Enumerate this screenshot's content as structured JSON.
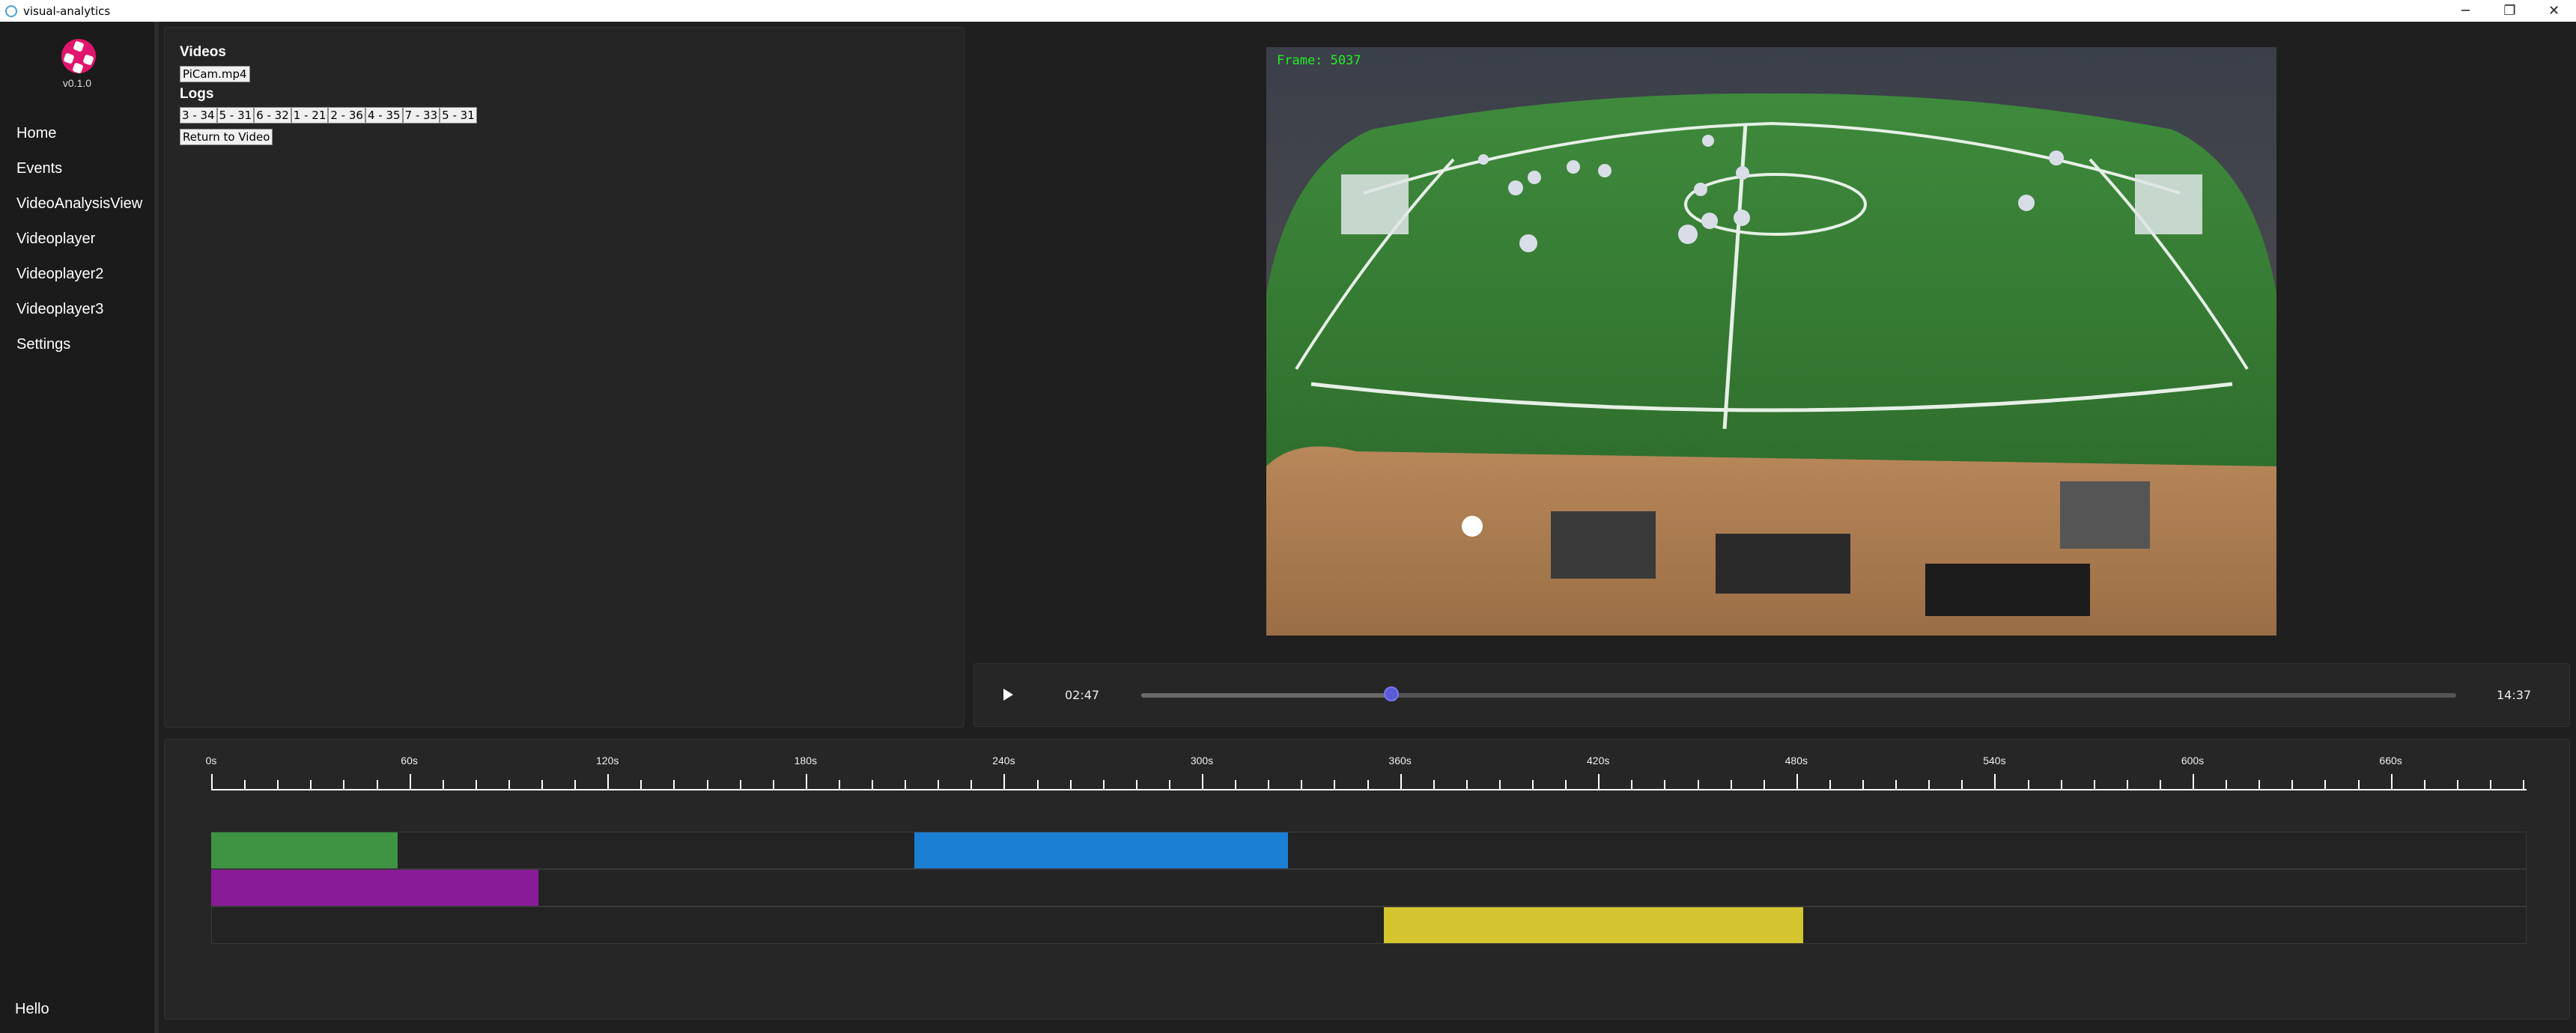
{
  "window": {
    "title": "visual-analytics",
    "controls": [
      "─",
      "❐",
      "✕"
    ]
  },
  "sidebar": {
    "version": "v0.1.0",
    "items": [
      {
        "label": "Home"
      },
      {
        "label": "Events"
      },
      {
        "label": "VideoAnalysisView"
      },
      {
        "label": "Videoplayer"
      },
      {
        "label": "Videoplayer2"
      },
      {
        "label": "Videoplayer3"
      },
      {
        "label": "Settings"
      }
    ],
    "footer": "Hello"
  },
  "videos": {
    "heading": "Videos",
    "files": [
      "PiCam.mp4"
    ]
  },
  "logs": {
    "heading": "Logs",
    "items": [
      "3 - 34",
      "5 - 31",
      "6 - 32",
      "1 - 21",
      "2 - 36",
      "4 - 35",
      "7 - 33",
      "5 - 31"
    ],
    "return_label": "Return to Video"
  },
  "player": {
    "frame_text": "Frame: 5037",
    "current_time": "02:47",
    "total_time": "14:37",
    "progress_fraction": 0.19
  },
  "timeline": {
    "tick_labels": [
      "0s",
      "60s",
      "120s",
      "180s",
      "240s",
      "300s",
      "360s",
      "420s",
      "480s",
      "540s",
      "600s",
      "660s"
    ],
    "max_seconds": 700,
    "events": [
      {
        "track": 0,
        "start": 0,
        "end": 56.5,
        "color": "#3e9443"
      },
      {
        "track": 0,
        "start": 213,
        "end": 326,
        "color": "#1b7fd3"
      },
      {
        "track": 1,
        "start": 0,
        "end": 99,
        "color": "#8a1b98"
      },
      {
        "track": 2,
        "start": 355,
        "end": 482,
        "color": "#d4c52f"
      }
    ]
  },
  "colors": {
    "accent": "#5b5bd6",
    "logo": "#e0156d",
    "frame_text": "#22ee22"
  }
}
